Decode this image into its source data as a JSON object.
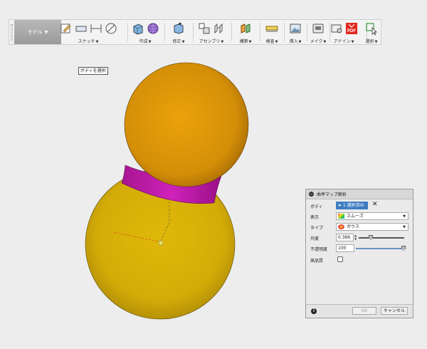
{
  "toolbar": {
    "mode": "モデル",
    "groups": [
      {
        "label": "スケッチ",
        "icons": [
          "sketch-create-icon",
          "rectangle-icon",
          "dimension-icon",
          "stop-sketch-icon"
        ]
      },
      {
        "label": "作成",
        "icons": [
          "extrude-icon",
          "form-icon"
        ]
      },
      {
        "label": "修正",
        "icons": [
          "press-pull-icon"
        ]
      },
      {
        "label": "アセンブリ",
        "icons": [
          "new-component-icon",
          "joint-icon"
        ]
      },
      {
        "label": "構築",
        "icons": [
          "offset-plane-icon"
        ]
      },
      {
        "label": "検査",
        "icons": [
          "measure-icon"
        ]
      },
      {
        "label": "挿入",
        "icons": [
          "insert-image-icon"
        ]
      },
      {
        "label": "メイク",
        "icons": [
          "make-3d-print-icon"
        ]
      },
      {
        "label": "アドイン",
        "icons": [
          "scripts-icon",
          "pdf-icon"
        ]
      },
      {
        "label": "選択",
        "icons": [
          "select-icon"
        ]
      }
    ]
  },
  "tooltip": "ボディを選択",
  "colors": {
    "upper_sphere": "#e09a0a",
    "neck": "#c51fb4",
    "lower_sphere": "#d9b20a",
    "accent": "#3f7dc2"
  },
  "dialog": {
    "title": "曲率マップ解析",
    "body_label": "ボディ",
    "body_value": "1 選択済み",
    "display_label": "表示",
    "display_value": "スムーズ",
    "type_label": "タイプ",
    "type_value": "ガウス",
    "scale_label": "尺度",
    "scale_value": "0.386",
    "opacity_label": "不透明度",
    "opacity_value": "100",
    "high_quality_label": "高品質",
    "ok": "OK",
    "cancel": "キャンセル"
  }
}
